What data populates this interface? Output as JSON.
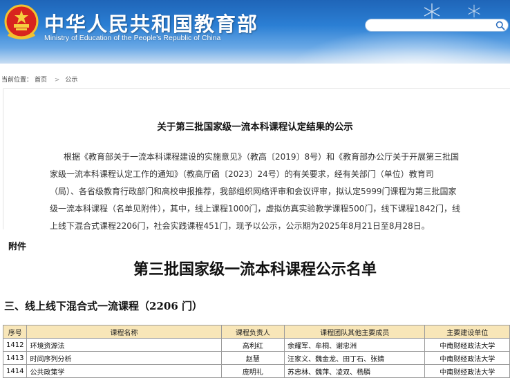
{
  "header": {
    "title": "中华人民共和国教育部",
    "subtitle": "Ministry of Education of the People's Republic of China",
    "search": {
      "placeholder": "",
      "icon": "search-icon"
    },
    "colors": {
      "banner_top": "#1f65b8",
      "banner_bottom": "#c9def3"
    }
  },
  "breadcrumb": {
    "prefix": "当前位置：",
    "items": [
      "首页",
      "公示"
    ],
    "separator": ">"
  },
  "notice": {
    "title": "关于第三批国家级一流本科课程认定结果的公示",
    "lines": [
      "根据《教育部关于一流本科课程建设的实施意见》（教高〔2019〕8号）和《教育部办公厅关于开展第三批国",
      "家级一流本科课程认定工作的通知》（教高厅函〔2023〕24号）的有关要求，经有关部门（单位）教育司",
      "（局）、各省级教育行政部门和高校申报推荐，我部组织网络评审和会议评审，拟认定5999门课程为第三批国家",
      "级一流本科课程（名单见附件），其中，线上课程1000门，虚拟仿真实验教学课程500门，线下课程1842门，线",
      "上线下混合式课程2206门，社会实践课程451门，现予以公示，公示期为2025年8月21日至8月28日。"
    ]
  },
  "attachment": {
    "label": "附件",
    "title": "第三批国家级一流本科课程公示名单",
    "section": "三、线上线下混合式一流课程（2206 门）",
    "table": {
      "headers": [
        "序号",
        "课程名称",
        "课程负责人",
        "课程团队其他主要成员",
        "主要建设单位"
      ],
      "rows": [
        [
          "1412",
          "环境资源法",
          "高利红",
          "余耀军、牟桐、谢忠洲",
          "中南财经政法大学"
        ],
        [
          "1413",
          "时间序列分析",
          "赵慧",
          "汪家义、魏金龙、田丁石、张婧",
          "中南财经政法大学"
        ],
        [
          "1414",
          "公共政策学",
          "庞明礼",
          "苏忠林、魏萍、凌双、杨膦",
          "中南财经政法大学"
        ]
      ],
      "header_bg": "#f8e6b8"
    }
  }
}
